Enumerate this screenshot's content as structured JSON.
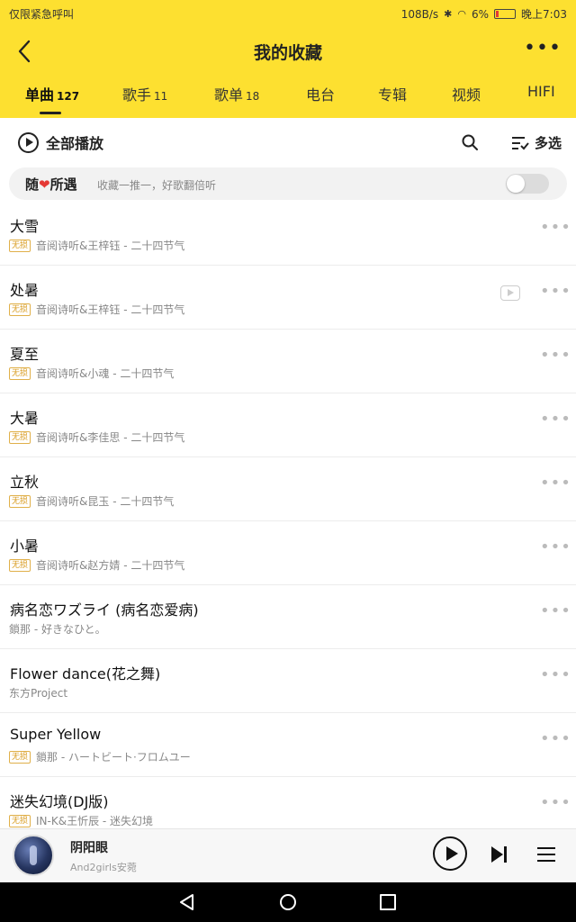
{
  "status_bar": {
    "left_text": "仅限紧急呼叫",
    "net_speed": "108B/s",
    "battery": "6%",
    "time": "晚上7:03"
  },
  "header": {
    "title": "我的收藏",
    "more": "•••"
  },
  "tabs": [
    {
      "label": "单曲",
      "count": "127"
    },
    {
      "label": "歌手",
      "count": "11"
    },
    {
      "label": "歌单",
      "count": "18"
    },
    {
      "label": "电台",
      "count": ""
    },
    {
      "label": "专辑",
      "count": ""
    },
    {
      "label": "视频",
      "count": ""
    },
    {
      "label": "HIFI",
      "count": ""
    }
  ],
  "toolbar": {
    "play_all": "全部播放",
    "multi_select": "多选"
  },
  "random": {
    "title_a": "随",
    "title_b": "所遇",
    "subtitle": "收藏一推一，好歌翻倍听",
    "toggle_on": false
  },
  "songs": [
    {
      "title": "大雪",
      "badge": "无损",
      "artist": "音阅诗听&王梓钰 - 二十四节气",
      "has_mv": false
    },
    {
      "title": "处暑",
      "badge": "无损",
      "artist": "音阅诗听&王梓钰 - 二十四节气",
      "has_mv": true
    },
    {
      "title": "夏至",
      "badge": "无损",
      "artist": "音阅诗听&小魂 - 二十四节气",
      "has_mv": false
    },
    {
      "title": "大暑",
      "badge": "无损",
      "artist": "音阅诗听&李佳思 - 二十四节气",
      "has_mv": false
    },
    {
      "title": "立秋",
      "badge": "无损",
      "artist": "音阅诗听&昆玉 - 二十四节气",
      "has_mv": false
    },
    {
      "title": "小暑",
      "badge": "无损",
      "artist": "音阅诗听&赵方婧 - 二十四节气",
      "has_mv": false
    },
    {
      "title": "病名恋ワズライ (病名恋爱病)",
      "badge": "",
      "artist": "鎖那 - 好きなひと。",
      "has_mv": false
    },
    {
      "title": "Flower dance(花之舞)",
      "badge": "",
      "artist": "东方Project",
      "has_mv": false
    },
    {
      "title": "Super Yellow",
      "badge": "无损",
      "artist": "鎖那 - ハートビート·フロムユー",
      "has_mv": false
    },
    {
      "title": "迷失幻境(DJ版)",
      "badge": "无损",
      "artist": "IN-K&王忻辰 - 迷失幻境",
      "has_mv": false
    }
  ],
  "now_playing": {
    "title": "阴阳眼",
    "artist": "And2girls安菀"
  },
  "colors": {
    "header_bg": "#fde030",
    "badge": "#d89a1c",
    "heart": "#e53935"
  }
}
